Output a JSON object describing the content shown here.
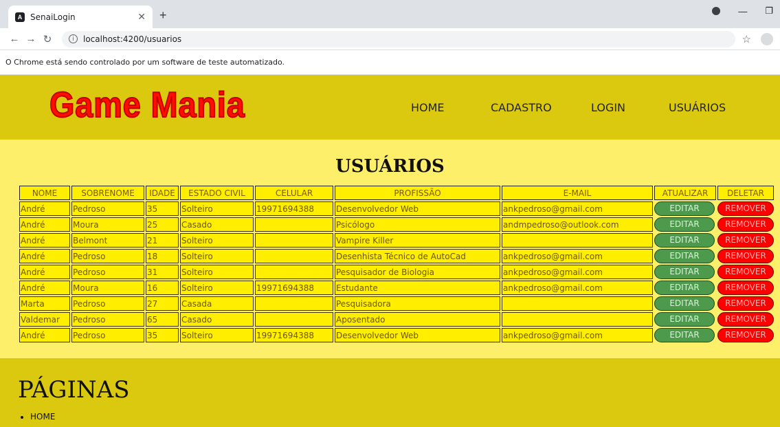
{
  "browser": {
    "tab_title": "SenaiLogin",
    "url": "localhost:4200/usuarios",
    "infobar_text": "O Chrome está sendo controlado por um software de teste automatizado."
  },
  "header": {
    "logo": "Game Mania",
    "nav": [
      "HOME",
      "CADASTRO",
      "LOGIN",
      "USUÁRIOS"
    ]
  },
  "main": {
    "title": "USUÁRIOS",
    "columns": [
      "NOME",
      "SOBRENOME",
      "IDADE",
      "ESTADO CIVIL",
      "CELULAR",
      "PROFISSÃO",
      "E-MAIL",
      "ATUALIZAR",
      "DELETAR"
    ],
    "edit_label": "EDITAR",
    "remove_label": "REMOVER",
    "rows": [
      [
        "André",
        "Pedroso",
        "35",
        "Solteiro",
        "19971694388",
        "Desenvolvedor Web",
        "ankpedroso@gmail.com"
      ],
      [
        "André",
        "Moura",
        "25",
        "Casado",
        "",
        "Psicólogo",
        "andmpedroso@outlook.com"
      ],
      [
        "André",
        "Belmont",
        "21",
        "Solteiro",
        "",
        "Vampire Killer",
        ""
      ],
      [
        "André",
        "Pedroso",
        "18",
        "Solteiro",
        "",
        "Desenhista Técnico de AutoCad",
        "ankpedroso@gmail.com"
      ],
      [
        "André",
        "Pedroso",
        "31",
        "Solteiro",
        "",
        "Pesquisador de Biologia",
        "ankpedroso@gmail.com"
      ],
      [
        "André",
        "Moura",
        "16",
        "Solteiro",
        "19971694388",
        "Estudante",
        "ankpedroso@gmail.com"
      ],
      [
        "Marta",
        "Pedroso",
        "27",
        "Casada",
        "",
        "Pesquisadora",
        ""
      ],
      [
        "Valdemar",
        "Pedroso",
        "65",
        "Casado",
        "",
        "Aposentado",
        ""
      ],
      [
        "André",
        "Pedroso",
        "35",
        "Solteiro",
        "19971694388",
        "Desenvolvedor Web",
        "ankpedroso@gmail.com"
      ]
    ]
  },
  "footer": {
    "title": "PÁGINAS",
    "links": [
      "HOME"
    ]
  }
}
